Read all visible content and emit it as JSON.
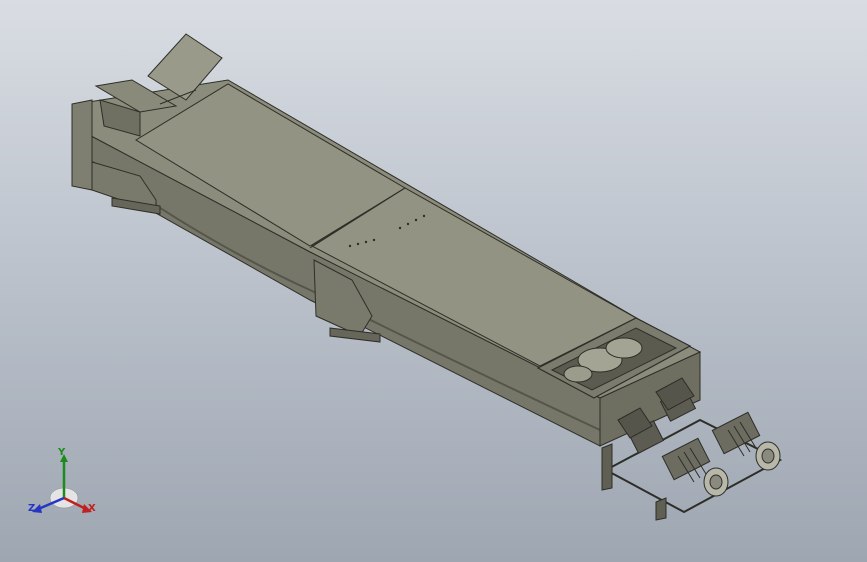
{
  "viewport": {
    "background_top": "#d9dde3",
    "background_bottom": "#9ea6b1"
  },
  "model": {
    "body_color": "#8f8f7f",
    "body_dark": "#6f6f62",
    "body_light": "#a9a99a",
    "edge_color": "#2e2e28"
  },
  "triad": {
    "x_label": "X",
    "y_label": "Y",
    "z_label": "Z",
    "x_color": "#c0201e",
    "y_color": "#1d8a1d",
    "z_color": "#2536c4"
  }
}
